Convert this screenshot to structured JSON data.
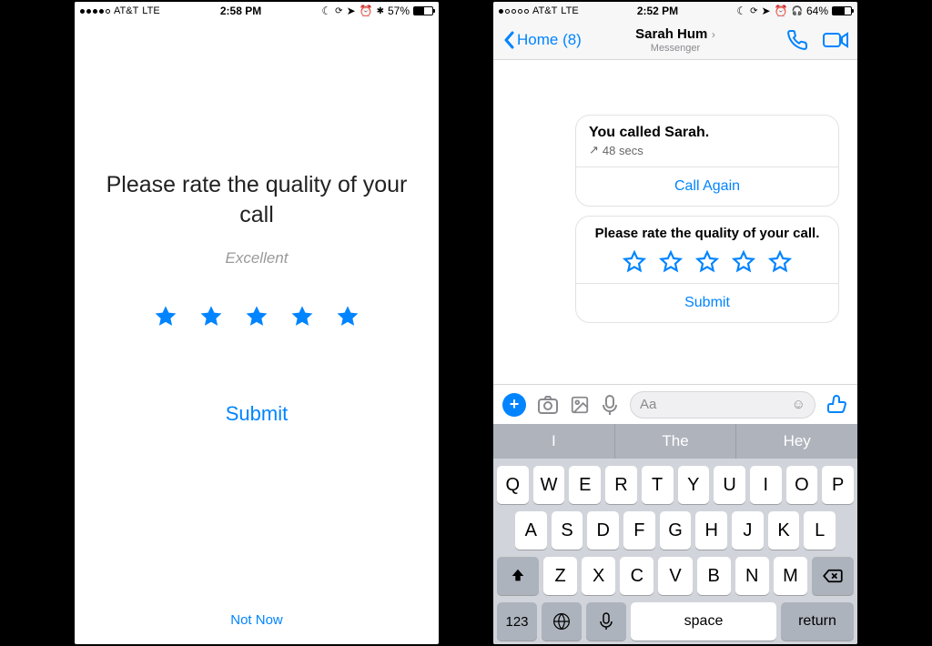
{
  "colors": {
    "accent": "#0084ff"
  },
  "left": {
    "status": {
      "signal_filled": 4,
      "carrier": "AT&T",
      "network": "LTE",
      "time": "2:58 PM",
      "battery_pct": "57%",
      "battery_fill": 57
    },
    "title": "Please rate the quality of your call",
    "rating_label": "Excellent",
    "rating_value": 5,
    "submit": "Submit",
    "not_now": "Not Now"
  },
  "right": {
    "status": {
      "signal_filled": 1,
      "carrier": "AT&T",
      "network": "LTE",
      "time": "2:52 PM",
      "battery_pct": "64%",
      "battery_fill": 64
    },
    "nav": {
      "back": "Home (8)",
      "title": "Sarah Hum",
      "subtitle": "Messenger"
    },
    "call_card": {
      "title": "You called Sarah.",
      "duration": "48 secs",
      "action": "Call Again"
    },
    "rate_card": {
      "prompt": "Please rate the quality of your call.",
      "submit": "Submit"
    },
    "compose": {
      "placeholder": "Aa"
    },
    "keyboard": {
      "suggestions": [
        "I",
        "The",
        "Hey"
      ],
      "row1": [
        "Q",
        "W",
        "E",
        "R",
        "T",
        "Y",
        "U",
        "I",
        "O",
        "P"
      ],
      "row2": [
        "A",
        "S",
        "D",
        "F",
        "G",
        "H",
        "J",
        "K",
        "L"
      ],
      "row3": [
        "Z",
        "X",
        "C",
        "V",
        "B",
        "N",
        "M"
      ],
      "n123": "123",
      "space": "space",
      "return": "return"
    }
  }
}
